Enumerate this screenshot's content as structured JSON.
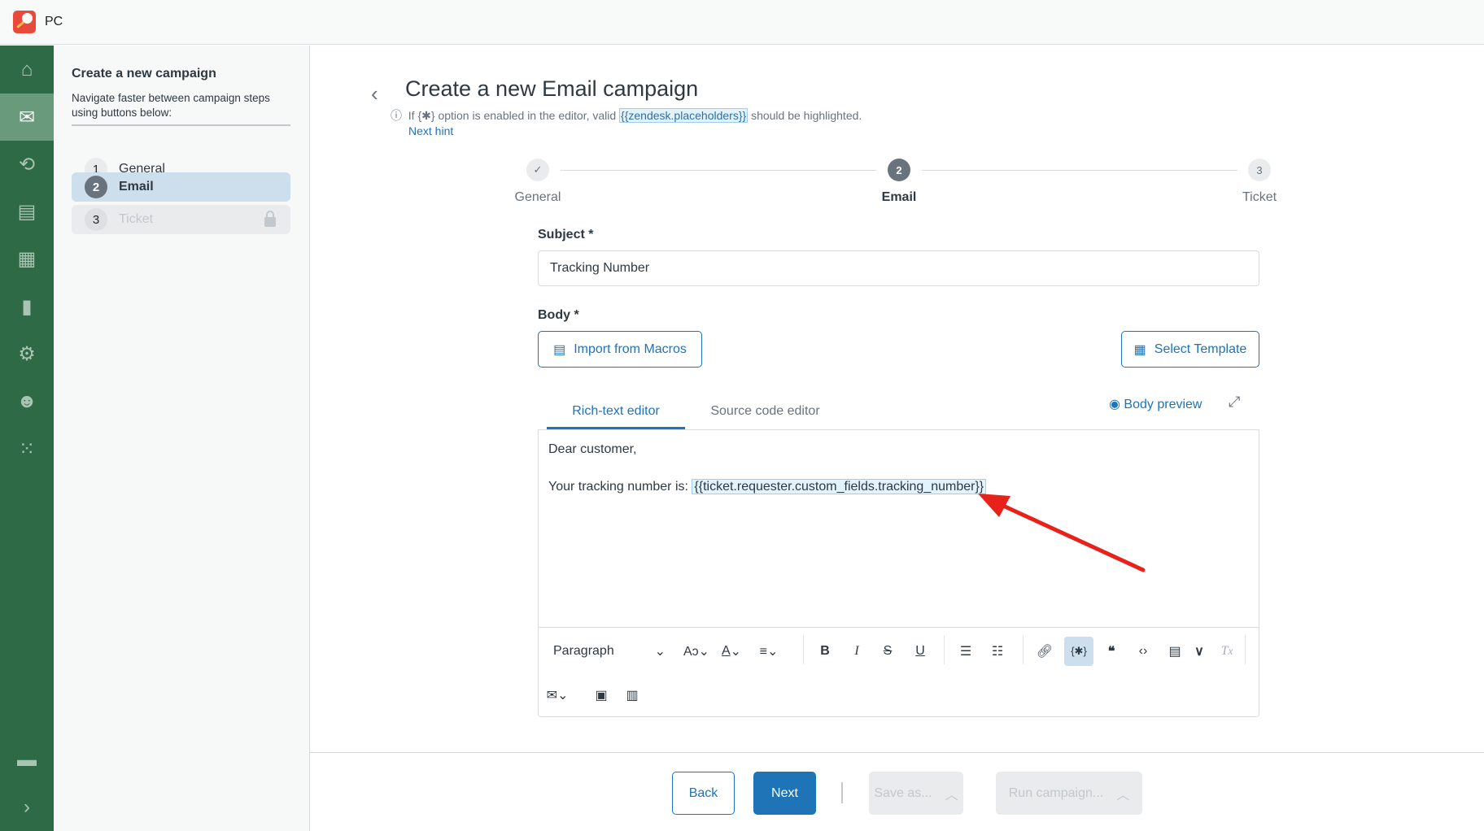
{
  "app": {
    "title": "PC",
    "brand_color": "#e9483b",
    "rail_color": "#2d6a45",
    "accent": "#1f73b7"
  },
  "rail": {
    "items": [
      "home-icon",
      "mail-icon",
      "automation-icon",
      "archive-icon",
      "add-widget-icon",
      "chart-icon",
      "gear-icon",
      "users-icon",
      "apps-grid-icon",
      "chat-icon",
      "chevron-right-icon"
    ],
    "active": "mail-icon"
  },
  "panel": {
    "title": "Create a new campaign",
    "description": "Navigate faster between campaign steps using buttons below:",
    "steps": [
      {
        "num": "1",
        "label": "General"
      },
      {
        "num": "2",
        "label": "Email",
        "state": "active"
      },
      {
        "num": "3",
        "label": "Ticket",
        "state": "locked"
      }
    ]
  },
  "main": {
    "title": "Create a new Email campaign",
    "hint": {
      "pre": "If",
      "icon": "{✱}",
      "mid": "option is enabled in the editor, valid",
      "placeholder": "{{zendesk.placeholders}}",
      "post": "should be highlighted.",
      "link": "Next hint"
    },
    "stepper": [
      {
        "label": "General",
        "state": "done"
      },
      {
        "num": "2",
        "label": "Email",
        "state": "active"
      },
      {
        "num": "3",
        "label": "Ticket",
        "state": "pending"
      }
    ],
    "subject": {
      "label": "Subject *",
      "value": "Tracking Number"
    },
    "body": {
      "label": "Body *",
      "import_label": "Import from Macros",
      "template_label": "Select Template",
      "tabs": [
        "Rich-text editor",
        "Source code editor"
      ],
      "active_tab": "Rich-text editor",
      "preview_label": "Body preview",
      "line1": "Dear customer,",
      "line2": "Your tracking number is:",
      "placeholder": "{{ticket.requester.custom_fields.tracking_number}}"
    },
    "toolbar": {
      "block_format": "Paragraph",
      "placeholder_toggle_active": true
    }
  },
  "footer": {
    "back": "Back",
    "next": "Next",
    "save": "Save as...",
    "run": "Run campaign..."
  }
}
